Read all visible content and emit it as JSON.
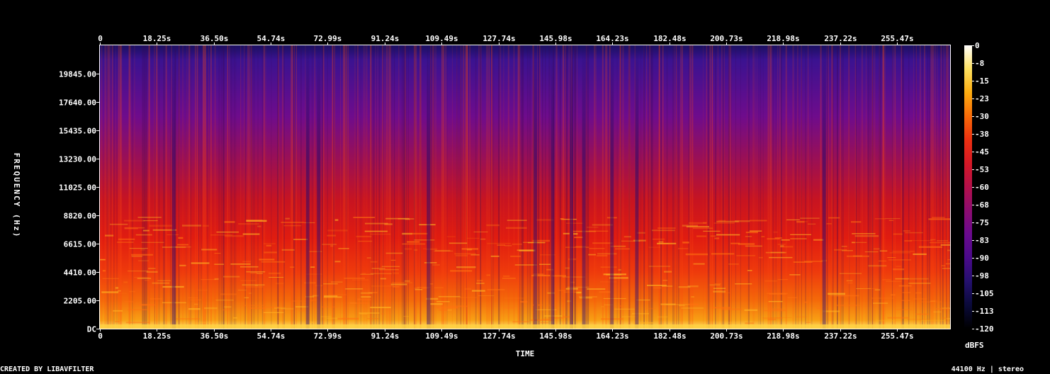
{
  "chart_data": {
    "type": "heatmap",
    "xlabel": "TIME",
    "ylabel": "FREQUENCY (Hz)",
    "x_ticks": [
      "0",
      "18.25s",
      "36.50s",
      "54.74s",
      "72.99s",
      "91.24s",
      "109.49s",
      "127.74s",
      "145.98s",
      "164.23s",
      "182.48s",
      "200.73s",
      "218.98s",
      "237.22s",
      "255.47s"
    ],
    "x_tick_values": [
      0,
      18.25,
      36.5,
      54.74,
      72.99,
      91.24,
      109.49,
      127.74,
      145.98,
      164.23,
      182.48,
      200.73,
      218.98,
      237.22,
      255.47
    ],
    "xlim": [
      0,
      272.5
    ],
    "y_ticks": [
      "DC",
      "2205.00",
      "4410.00",
      "6615.00",
      "8820.00",
      "11025.00",
      "13230.00",
      "15435.00",
      "17640.00",
      "19845.00"
    ],
    "y_tick_values": [
      0,
      2205,
      4410,
      6615,
      8820,
      11025,
      13230,
      15435,
      17640,
      19845
    ],
    "ylim": [
      0,
      22050
    ],
    "colorbar": {
      "label": "dBFS",
      "ticks": [
        "0",
        "-8",
        "-15",
        "-23",
        "-30",
        "-38",
        "-45",
        "-53",
        "-60",
        "-68",
        "-75",
        "-83",
        "-90",
        "-98",
        "-105",
        "-113",
        "-120"
      ],
      "range": [
        -120,
        0
      ],
      "colors": [
        "#000000",
        "#0a0a3a",
        "#24106e",
        "#4a0a8a",
        "#6a0a8e",
        "#8c0c70",
        "#b3104a",
        "#d41826",
        "#ec3010",
        "#f86a08",
        "#fcac10",
        "#fde060",
        "#ffffff"
      ]
    },
    "gaps_s": [
      23.5,
      66.5,
      70.0,
      105.2,
      139.5,
      145.0,
      151.0,
      155.0,
      164.0,
      172.0,
      232.0
    ]
  },
  "footer": {
    "left": "CREATED BY LIBAVFILTER",
    "right": "44100 Hz | stereo"
  }
}
